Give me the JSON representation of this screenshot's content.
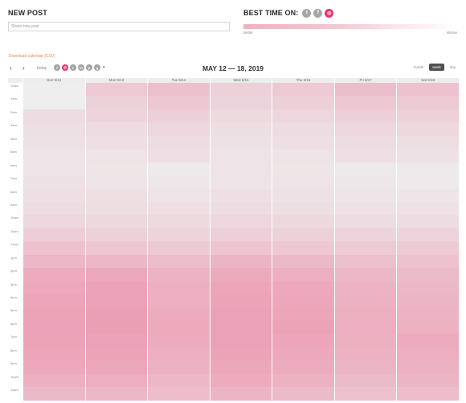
{
  "new_post": {
    "title": "NEW POST",
    "placeholder": "Share new post"
  },
  "best_time": {
    "title": "BEST TIME ON:",
    "networks": [
      {
        "icon": "twitter-icon",
        "glyph": "t",
        "active": false
      },
      {
        "icon": "facebook-icon",
        "glyph": "f",
        "active": false
      },
      {
        "icon": "instagram-icon",
        "glyph": "◎",
        "active": true
      }
    ],
    "scale_better": "Better",
    "scale_worse": "Worse"
  },
  "download_label": "Download calendar (CSV)",
  "toolbar": {
    "prev": "‹",
    "next": "›",
    "today": "today",
    "range_title": "MAY 12 — 18, 2019",
    "mini_networks": [
      {
        "icon": "facebook-icon",
        "glyph": "f",
        "active": false
      },
      {
        "icon": "instagram-icon",
        "glyph": "◎",
        "active": true
      },
      {
        "icon": "twitter-icon",
        "glyph": "t",
        "active": false
      },
      {
        "icon": "linkedin-icon",
        "glyph": "in",
        "active": false
      },
      {
        "icon": "pinterest-icon",
        "glyph": "p",
        "active": false
      },
      {
        "icon": "google-icon",
        "glyph": "g",
        "active": false
      }
    ],
    "mini_caret": "▾",
    "views": [
      {
        "label": "month",
        "active": false
      },
      {
        "label": "week",
        "active": true
      },
      {
        "label": "day",
        "active": false
      }
    ]
  },
  "calendar": {
    "days": [
      "Sun 5/12",
      "Mon 5/13",
      "Tue 5/14",
      "Wed 5/15",
      "Thu 5/16",
      "Fri 5/17",
      "Sat 5/18"
    ],
    "hours": [
      "12am",
      "1am",
      "2am",
      "3am",
      "4am",
      "5am",
      "6am",
      "7am",
      "8am",
      "9am",
      "10am",
      "11am",
      "12pm",
      "1pm",
      "2pm",
      "3pm",
      "4pm",
      "5pm",
      "6pm",
      "7pm",
      "8pm",
      "9pm",
      "10pm",
      "11pm"
    ],
    "heat_color": "#e8376a",
    "heat": [
      [
        0.0,
        0.2,
        0.25,
        0.16,
        0.2,
        0.26,
        0.24
      ],
      [
        0.0,
        0.16,
        0.21,
        0.14,
        0.17,
        0.21,
        0.2
      ],
      [
        0.1,
        0.14,
        0.17,
        0.11,
        0.13,
        0.17,
        0.16
      ],
      [
        0.08,
        0.1,
        0.13,
        0.09,
        0.1,
        0.13,
        0.12
      ],
      [
        0.07,
        0.08,
        0.1,
        0.07,
        0.08,
        0.1,
        0.09
      ],
      [
        0.06,
        0.06,
        0.08,
        0.06,
        0.06,
        0.08,
        0.07
      ],
      [
        0.06,
        0.05,
        0.03,
        0.06,
        0.05,
        0.03,
        0.03
      ],
      [
        0.07,
        0.06,
        0.04,
        0.06,
        0.06,
        0.04,
        0.03
      ],
      [
        0.08,
        0.08,
        0.06,
        0.08,
        0.07,
        0.05,
        0.05
      ],
      [
        0.1,
        0.09,
        0.08,
        0.1,
        0.09,
        0.07,
        0.07
      ],
      [
        0.13,
        0.12,
        0.11,
        0.13,
        0.12,
        0.1,
        0.1
      ],
      [
        0.18,
        0.16,
        0.15,
        0.17,
        0.16,
        0.14,
        0.14
      ],
      [
        0.24,
        0.22,
        0.2,
        0.23,
        0.21,
        0.19,
        0.19
      ],
      [
        0.3,
        0.3,
        0.27,
        0.31,
        0.29,
        0.25,
        0.24
      ],
      [
        0.36,
        0.38,
        0.32,
        0.37,
        0.35,
        0.3,
        0.28
      ],
      [
        0.38,
        0.41,
        0.34,
        0.4,
        0.38,
        0.32,
        0.3
      ],
      [
        0.4,
        0.42,
        0.35,
        0.41,
        0.39,
        0.33,
        0.31
      ],
      [
        0.41,
        0.43,
        0.36,
        0.42,
        0.4,
        0.34,
        0.32
      ],
      [
        0.42,
        0.43,
        0.37,
        0.42,
        0.41,
        0.35,
        0.33
      ],
      [
        0.41,
        0.42,
        0.36,
        0.42,
        0.4,
        0.34,
        0.36
      ],
      [
        0.4,
        0.41,
        0.35,
        0.41,
        0.38,
        0.33,
        0.35
      ],
      [
        0.38,
        0.39,
        0.33,
        0.39,
        0.36,
        0.31,
        0.33
      ],
      [
        0.34,
        0.35,
        0.3,
        0.36,
        0.33,
        0.28,
        0.31
      ],
      [
        0.29,
        0.3,
        0.26,
        0.31,
        0.28,
        0.24,
        0.27
      ]
    ]
  }
}
